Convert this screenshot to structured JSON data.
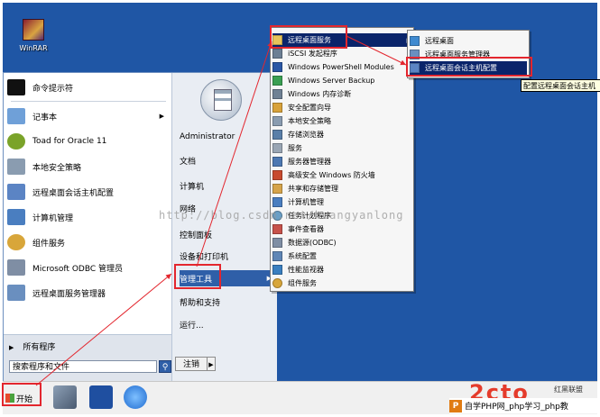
{
  "desktop": {
    "icon_label": "WinRAR"
  },
  "start_menu": {
    "left_items": [
      {
        "label": "命令提示符",
        "icon": "cmd-icon",
        "color": "#111111"
      },
      {
        "label": "记事本",
        "icon": "notepad-icon",
        "color": "#6fa0d8",
        "has_submenu": true
      },
      {
        "label": "Toad for Oracle 11",
        "icon": "toad-icon",
        "color": "#7aa329"
      },
      {
        "label": "本地安全策略",
        "icon": "security-policy-icon",
        "color": "#8a9cb0"
      },
      {
        "label": "远程桌面会话主机配置",
        "icon": "rdsh-config-icon",
        "color": "#5b84c4"
      },
      {
        "label": "计算机管理",
        "icon": "computer-management-icon",
        "color": "#4a7ec0"
      },
      {
        "label": "组件服务",
        "icon": "component-services-icon",
        "color": "#d8a63a"
      },
      {
        "label": "Microsoft ODBC 管理员",
        "icon": "odbc-icon",
        "color": "#7f8ea4"
      },
      {
        "label": "远程桌面服务管理器",
        "icon": "rds-manager-icon",
        "color": "#6a8fbf"
      }
    ],
    "all_programs": "所有程序",
    "search_placeholder": "搜索程序和文件",
    "right_items": [
      {
        "label": "Administrator"
      },
      {
        "label": "文档"
      },
      {
        "label": "计算机"
      },
      {
        "label": "网络"
      },
      {
        "label": "控制面板"
      },
      {
        "label": "设备和打印机"
      },
      {
        "label": "管理工具",
        "has_submenu": true,
        "selected": true
      },
      {
        "label": "帮助和支持"
      },
      {
        "label": "运行..."
      }
    ],
    "logoff": "注销"
  },
  "admin_tools_menu": [
    {
      "label": "远程桌面服务",
      "has_submenu": true,
      "selected": true,
      "color": "#e8c45a"
    },
    {
      "label": "iSCSI 发起程序",
      "color": "#6c7f94"
    },
    {
      "label": "Windows PowerShell Modules",
      "color": "#2a57a5"
    },
    {
      "label": "Windows Server Backup",
      "color": "#3a9f52"
    },
    {
      "label": "Windows 内存诊断",
      "color": "#6f8194"
    },
    {
      "label": "安全配置向导",
      "color": "#d8a23a"
    },
    {
      "label": "本地安全策略",
      "color": "#8a9cb0"
    },
    {
      "label": "存储浏览器",
      "color": "#5a7fa8"
    },
    {
      "label": "服务",
      "color": "#9aa6b4"
    },
    {
      "label": "服务器管理器",
      "color": "#4d78b2"
    },
    {
      "label": "高级安全 Windows 防火墙",
      "color": "#c84b2e"
    },
    {
      "label": "共享和存储管理",
      "color": "#d6a44a"
    },
    {
      "label": "计算机管理",
      "color": "#4a7ec0"
    },
    {
      "label": "任务计划程序",
      "color": "#6a9fc6"
    },
    {
      "label": "事件查看器",
      "color": "#c7524a"
    },
    {
      "label": "数据源(ODBC)",
      "color": "#7f8ea4"
    },
    {
      "label": "系统配置",
      "color": "#5f86b6"
    },
    {
      "label": "性能监视器",
      "color": "#3a7fc0"
    },
    {
      "label": "组件服务",
      "color": "#d8a63a"
    }
  ],
  "rds_menu": [
    {
      "label": "远程桌面",
      "color": "#3f8ad0"
    },
    {
      "label": "远程桌面服务管理器",
      "color": "#6a8fbf"
    },
    {
      "label": "远程桌面会话主机配置",
      "selected": true,
      "color": "#5b84c4"
    }
  ],
  "tooltip": "配置远程桌面会话主机",
  "watermark": "http://blog.csdn.net/huangyanlong",
  "taskbar": {
    "start_label": "开始"
  },
  "branding": {
    "big_text": "2cto",
    "small_text": "红黑联盟",
    "bar_text": "自学PHP网_php学习_php教"
  }
}
